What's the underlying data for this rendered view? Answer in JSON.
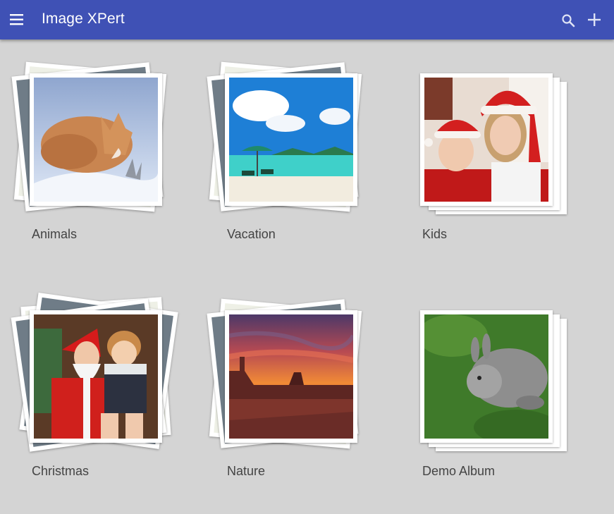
{
  "app": {
    "title": "Image XPert"
  },
  "toolbar": {
    "menu_icon": "menu-icon",
    "search_icon": "search-icon",
    "add_icon": "add-icon"
  },
  "albums": [
    {
      "label": "Animals",
      "stack_style": "rotated",
      "cover": "sleeping fox in snow"
    },
    {
      "label": "Vacation",
      "stack_style": "rotated",
      "cover": "tropical beach with umbrella"
    },
    {
      "label": "Kids",
      "stack_style": "straight",
      "cover": "two kids in santa hats"
    },
    {
      "label": "Christmas",
      "stack_style": "rotated",
      "cover": "santa with child"
    },
    {
      "label": "Nature",
      "stack_style": "rotated",
      "cover": "desert sunset mesas"
    },
    {
      "label": "Demo Album",
      "stack_style": "straight",
      "cover": "grey rabbit on grass"
    }
  ],
  "colors": {
    "appbar": "#3f51b5",
    "background": "#d4d4d4",
    "label": "#444444"
  }
}
